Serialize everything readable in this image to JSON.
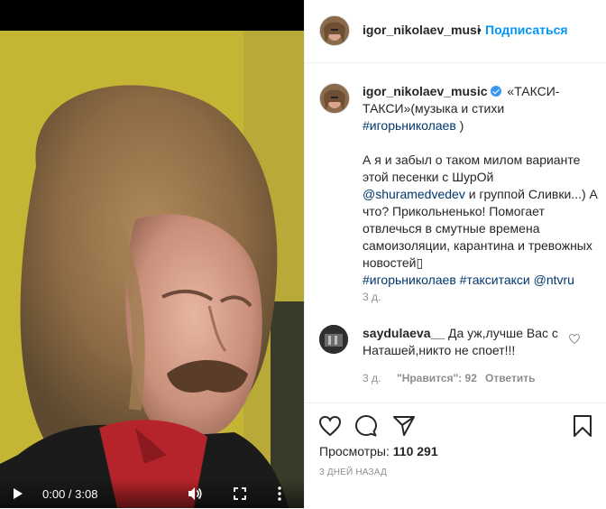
{
  "video": {
    "current_time": "0:00",
    "separator": " / ",
    "duration": "3:08",
    "play_icon": "play-icon",
    "volume_icon": "volume-icon",
    "fullscreen_icon": "fullscreen-icon",
    "more_icon": "more-vertical-icon"
  },
  "header": {
    "username": "igor_nikolaev_musi",
    "dot": "•",
    "follow_label": "Подписаться"
  },
  "caption": {
    "username": "igor_nikolaev_music",
    "line1_text": " «ТАКСИ-ТАКСИ»(музыка и стихи ",
    "hashtag1": "#игорьниколаев",
    "line1_end": " )",
    "para2_a": "А я и забыл о таком милом варианте этой песенки с ШурОй ",
    "mention1": "@shuramedvedev",
    "para2_b": " и группой Сливки...) А что? Прикольненько! Помогает отвлечься в смутные времена самоизоляции, карантина и тревожных новостей▯",
    "hashtag2": "#игорьниколаев",
    "hashtag3": "#такситакси",
    "mention2": "@ntvru",
    "time": "3 д."
  },
  "comment": {
    "username": "saydulaeva__",
    "text": " Да уж,лучше Вас с Наташей,никто не споет!!!",
    "time": "3 д.",
    "likes": "\"Нравится\": 92",
    "reply_label": "Ответить"
  },
  "stats": {
    "views_label": "Просмотры:",
    "views_value": "110 291",
    "date": "3 ДНЕЙ НАЗАД"
  },
  "colors": {
    "accent": "#0095f6",
    "link": "#00376b",
    "muted": "#8e8e8e",
    "text": "#262626"
  }
}
